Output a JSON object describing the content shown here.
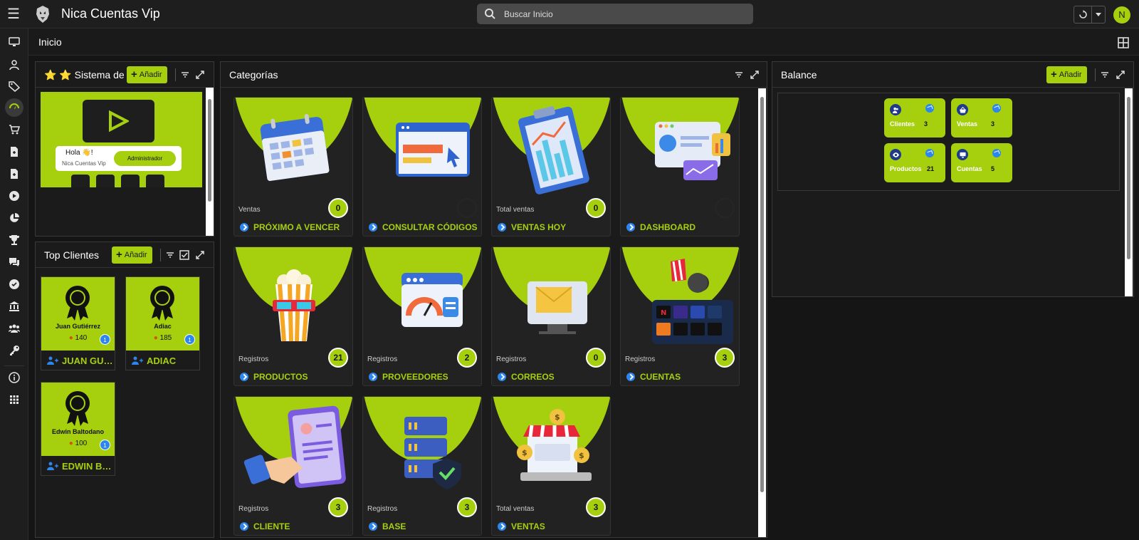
{
  "app": {
    "title": "Nica Cuentas Vip",
    "avatar_initial": "N"
  },
  "search": {
    "placeholder": "Buscar Inicio"
  },
  "breadcrumb": {
    "title": "Inicio"
  },
  "colors": {
    "accent": "#a6d00e",
    "badge_blue": "#2d86ee",
    "bg": "#151515"
  },
  "sidebar": {
    "items": [
      "monitor-icon",
      "user-icon",
      "tag-icon",
      "dashboard-icon",
      "cart-icon",
      "file-add-icon",
      "file-add-icon",
      "play-circle-icon",
      "pie-chart-icon",
      "trophy-icon",
      "chat-icon",
      "verified-icon",
      "bank-icon",
      "group-icon",
      "key-icon",
      "info-icon",
      "apps-icon"
    ]
  },
  "sistema": {
    "title": "⭐ ⭐ Sistema de C",
    "add_label": "Añadir",
    "greeting": "Hola 👋!",
    "company": "Nica Cuentas Vip",
    "role_button": "Administrador"
  },
  "top_clientes": {
    "title": "Top Clientes",
    "add_label": "Añadir",
    "clients": [
      {
        "name": "Juan Gutiérrez",
        "points": "140",
        "badge": "1",
        "footer": "JUAN GUTIÉRREZ"
      },
      {
        "name": "Adiac",
        "points": "185",
        "badge": "1",
        "footer": "ADIAC"
      },
      {
        "name": "Edwin Baltodano",
        "points": "100",
        "badge": "1",
        "footer": "EDWIN BALTODANO"
      }
    ]
  },
  "categorias": {
    "title": "Categorías",
    "cards": [
      {
        "sub": "Ventas",
        "count": "0",
        "label": "PRÓXIMO A VENCER",
        "art": "calendar"
      },
      {
        "sub": "",
        "count": "",
        "label": "CONSULTAR CÓDIGOS",
        "art": "browser"
      },
      {
        "sub": "Total ventas",
        "count": "0",
        "label": "VENTAS HOY",
        "art": "clipboard"
      },
      {
        "sub": "",
        "count": "",
        "label": "DASHBOARD",
        "art": "dashboard"
      },
      {
        "sub": "Registros",
        "count": "21",
        "label": "PRODUCTOS",
        "art": "popcorn"
      },
      {
        "sub": "Registros",
        "count": "2",
        "label": "PROVEEDORES",
        "art": "gauge"
      },
      {
        "sub": "Registros",
        "count": "0",
        "label": "CORREOS",
        "art": "mail"
      },
      {
        "sub": "Registros",
        "count": "3",
        "label": "CUENTAS",
        "art": "tablet"
      },
      {
        "sub": "Registros",
        "count": "3",
        "label": "CLIENTE",
        "art": "handshake"
      },
      {
        "sub": "Registros",
        "count": "3",
        "label": "BASE",
        "art": "server"
      },
      {
        "sub": "Total ventas",
        "count": "3",
        "label": "VENTAS",
        "art": "store"
      }
    ]
  },
  "balance": {
    "title": "Balance",
    "add_label": "Añadir",
    "tiles": [
      {
        "label": "Clientes",
        "value": "3",
        "icon": "users-icon"
      },
      {
        "label": "Ventas",
        "value": "3",
        "icon": "basket-icon"
      },
      {
        "label": "Productos",
        "value": "21",
        "icon": "eye-icon"
      },
      {
        "label": "Cuentas",
        "value": "5",
        "icon": "monitor-icon"
      }
    ]
  }
}
